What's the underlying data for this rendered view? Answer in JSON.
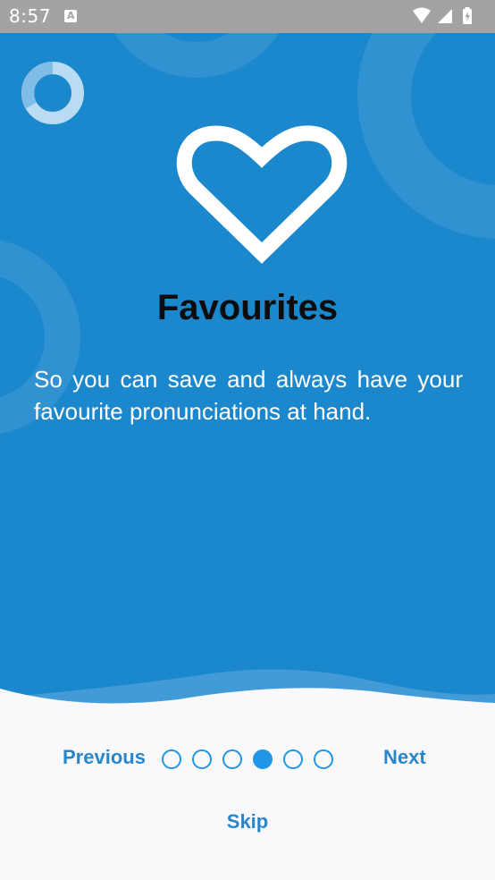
{
  "status_bar": {
    "time": "8:57",
    "notification_icon": "a-text-icon",
    "icons": [
      "wifi-icon",
      "cellular-signal-icon",
      "battery-charging-icon"
    ]
  },
  "onboarding": {
    "logo_icon": "ring-logo-icon",
    "feature_icon": "heart-outline-icon",
    "title": "Favourites",
    "description": "So you can save and always have your favourite pronunciations at hand."
  },
  "navigation": {
    "previous_label": "Previous",
    "next_label": "Next",
    "skip_label": "Skip",
    "page_count": 6,
    "current_page": 4
  },
  "colors": {
    "background": "#1b87cc",
    "accent": "#2196e8",
    "link": "#2a86cb",
    "panel": "#f9f9fb",
    "status_bar": "#a3a3a3"
  }
}
